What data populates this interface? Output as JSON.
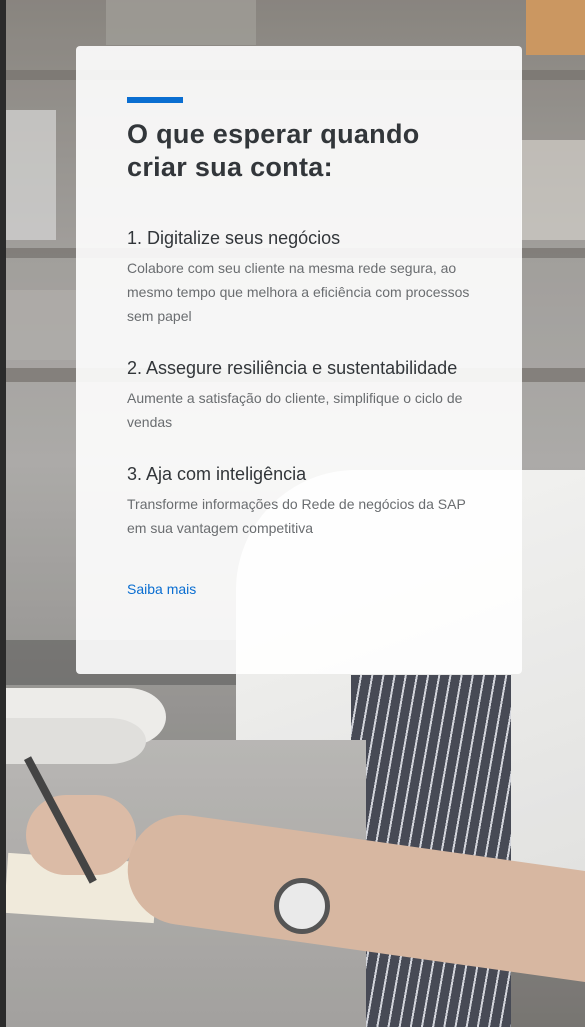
{
  "card": {
    "title": "O que esperar quando criar sua conta:",
    "steps": [
      {
        "title": "1. Digitalize seus negócios",
        "description": "Colabore com seu cliente na mesma rede segura, ao mesmo tempo que melhora a eficiência com processos sem papel"
      },
      {
        "title": "2. Assegure resiliência e sustentabilidade",
        "description": "Aumente a satisfação do cliente, simplifique o ciclo de vendas"
      },
      {
        "title": "3. Aja com inteligência",
        "description": "Transforme informações do Rede de negócios da SAP em sua vantagem competitiva"
      }
    ],
    "learn_more_label": "Saiba mais"
  },
  "colors": {
    "accent": "#0a6ed1",
    "title_text": "#32363a",
    "body_text": "#6a6d70"
  }
}
